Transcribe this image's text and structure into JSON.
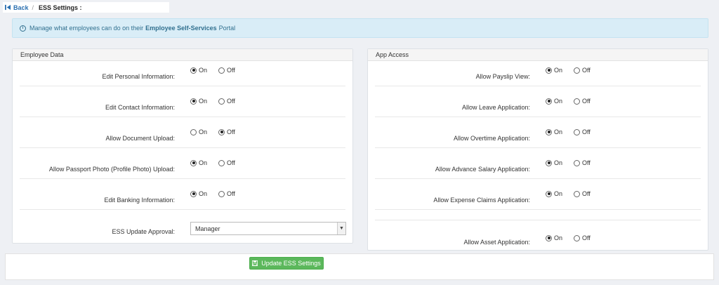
{
  "breadcrumb": {
    "back_label": "Back",
    "separator": "/",
    "title": "ESS Settings :"
  },
  "info": {
    "text_before": "Manage what employees can do on their",
    "highlight": "Employee Self-Services",
    "text_after": "Portal"
  },
  "employee_data": {
    "heading": "Employee Data",
    "rows": [
      {
        "label": "Edit Personal Information:",
        "on_label": "On",
        "off_label": "Off",
        "selected": "On"
      },
      {
        "label": "Edit Contact Information:",
        "on_label": "On",
        "off_label": "Off",
        "selected": "On"
      },
      {
        "label": "Allow Document Upload:",
        "on_label": "On",
        "off_label": "Off",
        "selected": "Off"
      },
      {
        "label": "Allow Passport Photo (Profile Photo) Upload:",
        "on_label": "On",
        "off_label": "Off",
        "selected": "On"
      },
      {
        "label": "Edit Banking Information:",
        "on_label": "On",
        "off_label": "Off",
        "selected": "On"
      }
    ],
    "approval": {
      "label": "ESS Update Approval:",
      "value": "Manager"
    }
  },
  "app_access": {
    "heading": "App Access",
    "rows": [
      {
        "label": "Allow Payslip View:",
        "on_label": "On",
        "off_label": "Off",
        "selected": "On"
      },
      {
        "label": "Allow Leave Application:",
        "on_label": "On",
        "off_label": "Off",
        "selected": "On"
      },
      {
        "label": "Allow Overtime Application:",
        "on_label": "On",
        "off_label": "Off",
        "selected": "On"
      },
      {
        "label": "Allow Advance Salary Application:",
        "on_label": "On",
        "off_label": "Off",
        "selected": "On"
      },
      {
        "label": "Allow Expense Claims Application:",
        "on_label": "On",
        "off_label": "Off",
        "selected": "On"
      },
      {
        "label": "Allow Asset Application:",
        "on_label": "On",
        "off_label": "Off",
        "selected": "On"
      }
    ]
  },
  "footer": {
    "update_label": "Update ESS Settings"
  }
}
